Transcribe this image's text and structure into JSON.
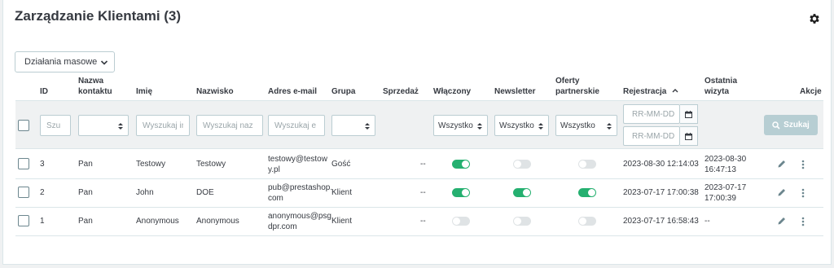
{
  "page": {
    "title": "Zarządzanie Klientami (3)",
    "bulk_actions_label": "Działania masowe"
  },
  "columns": {
    "id": "ID",
    "contact_name_line1": "Nazwa",
    "contact_name_line2": "kontaktu",
    "first_name": "Imię",
    "last_name": "Nazwisko",
    "email": "Adres e-mail",
    "group": "Grupa",
    "sales": "Sprzedaż",
    "enabled": "Włączony",
    "newsletter": "Newsletter",
    "offers_line1": "Oferty",
    "offers_line2": "partnerskie",
    "registration": "Rejestracja",
    "last_visit_line1": "Ostatnia",
    "last_visit_line2": "wizyta",
    "actions": "Akcje"
  },
  "filters": {
    "id_placeholder": "Szu",
    "first_name_placeholder": "Wyszukaj imię",
    "last_name_placeholder": "Wyszukaj naz",
    "email_placeholder": "Wyszukaj e",
    "enabled_value": "Wszystko",
    "newsletter_value": "Wszystko",
    "offers_value": "Wszystko",
    "date_from_placeholder": "RR-MM-DD",
    "date_to_placeholder": "RR-MM-DD",
    "search_label": "Szukaj"
  },
  "rows": [
    {
      "id": "3",
      "title": "Pan",
      "first_name": "Testowy",
      "last_name": "Testowy",
      "email_line1": "testowy@testow",
      "email_line2": "y.pl",
      "group": "Gość",
      "sales": "--",
      "enabled": true,
      "newsletter": false,
      "offers": false,
      "registration": "2023-08-30 12:14:03",
      "last_visit_line1": "2023-08-30",
      "last_visit_line2": "16:47:13"
    },
    {
      "id": "2",
      "title": "Pan",
      "first_name": "John",
      "last_name": "DOE",
      "email_line1": "pub@prestashop.",
      "email_line2": "com",
      "group": "Klient",
      "sales": "--",
      "enabled": true,
      "newsletter": true,
      "offers": true,
      "registration": "2023-07-17 17:00:38",
      "last_visit_line1": "2023-07-17",
      "last_visit_line2": "17:00:39"
    },
    {
      "id": "1",
      "title": "Pan",
      "first_name": "Anonymous",
      "last_name": "Anonymous",
      "email_line1": "anonymous@psg",
      "email_line2": "dpr.com",
      "group": "Klient",
      "sales": "--",
      "enabled": false,
      "newsletter": false,
      "offers": false,
      "registration": "2023-07-17 16:58:43",
      "last_visit_line1": "--",
      "last_visit_line2": ""
    }
  ],
  "colors": {
    "toggle_on": "#25b070",
    "toggle_off": "#dfe3e5",
    "search_button": "#b7ced3"
  }
}
